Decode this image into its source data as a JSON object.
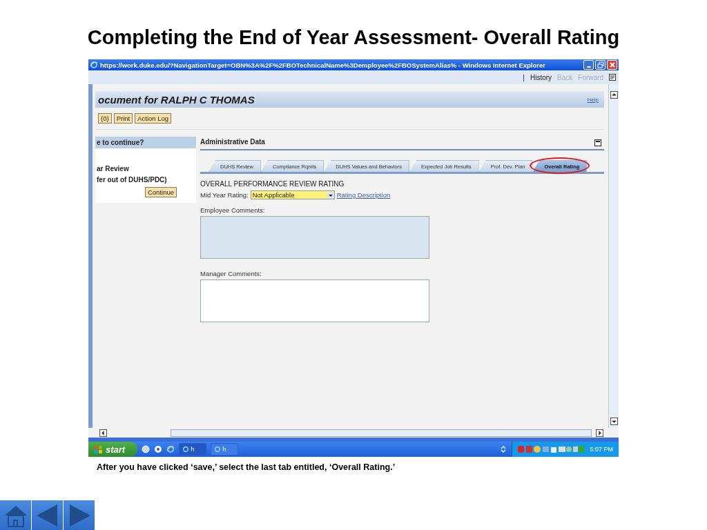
{
  "slide": {
    "title": "Completing the End of Year Assessment- Overall Rating",
    "caption": "After you have clicked ‘save,’ select the last tab entitled, ‘Overall Rating.’"
  },
  "browser": {
    "title": "https://work.duke.edu/?NavigationTarget=OBN%3A%2F%2FBOTechnicalName%3Demployee%2FBOSystemAlias% - Windows Internet Explorer",
    "command_bar": [
      {
        "label": "|",
        "disabled": false
      },
      {
        "label": "History",
        "disabled": false
      },
      {
        "label": "Back",
        "disabled": true
      },
      {
        "label": "Forward",
        "disabled": true
      }
    ]
  },
  "page": {
    "heading": "ocument for RALPH C THOMAS",
    "help": "Help",
    "toolbar": [
      "(0)",
      "Print",
      "Action Log"
    ],
    "left_panel": {
      "header": "e to continue?",
      "lines": [
        "ar Review",
        "fer out of DUHS/PDC)"
      ],
      "button": "Continue"
    },
    "section": "Administrative Data",
    "tabs": [
      {
        "label": "DUHS Review",
        "selected": false,
        "highlighted": false
      },
      {
        "label": "Compliance Rqmts",
        "selected": false,
        "highlighted": false
      },
      {
        "label": "DUHS Values and Behaviors",
        "selected": false,
        "highlighted": false
      },
      {
        "label": "Expected Job Results",
        "selected": false,
        "highlighted": false
      },
      {
        "label": "Prof. Dev. Plan",
        "selected": false,
        "highlighted": false
      },
      {
        "label": "Overall Rating",
        "selected": true,
        "highlighted": true
      }
    ],
    "form_heading": "OVERALL PERFORMANCE REVIEW RATING",
    "rating": {
      "label": "Mid Year Rating:",
      "value": "Not Applicable",
      "link": "Rating Description"
    },
    "comments": [
      {
        "label": "Employee Comments:",
        "disabled": true
      },
      {
        "label": "Manager Comments:",
        "disabled": false
      }
    ]
  },
  "taskbar": {
    "start": "start",
    "tasks": [
      "h.",
      "h."
    ],
    "time": "5:07 PM"
  }
}
